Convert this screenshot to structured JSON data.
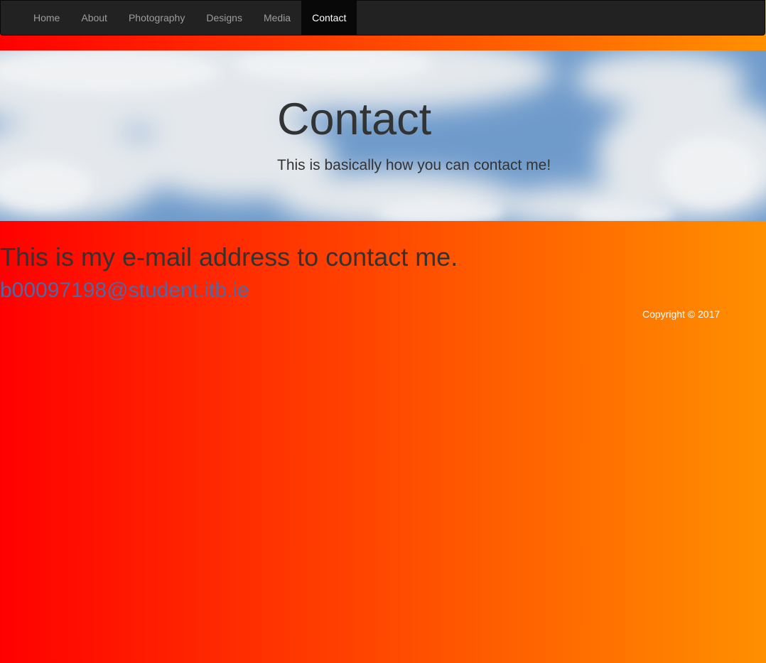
{
  "nav": {
    "items": [
      {
        "label": "Home",
        "active": false
      },
      {
        "label": "About",
        "active": false
      },
      {
        "label": "Photography",
        "active": false
      },
      {
        "label": "Designs",
        "active": false
      },
      {
        "label": "Media",
        "active": false
      },
      {
        "label": "Contact",
        "active": true
      }
    ]
  },
  "hero": {
    "title": "Contact",
    "subtitle": "This is basically how you can contact me!"
  },
  "main": {
    "heading": "This is my e-mail address to contact me.",
    "email": "b00097198@student.itb.ie"
  },
  "footer": {
    "copyright": "Copyright © 2017"
  },
  "colors": {
    "gradient_start": "#ff0000",
    "gradient_end": "#ff9000",
    "navbar_bg": "#222222",
    "nav_active_bg": "#080808",
    "link": "#4a6aa8"
  }
}
